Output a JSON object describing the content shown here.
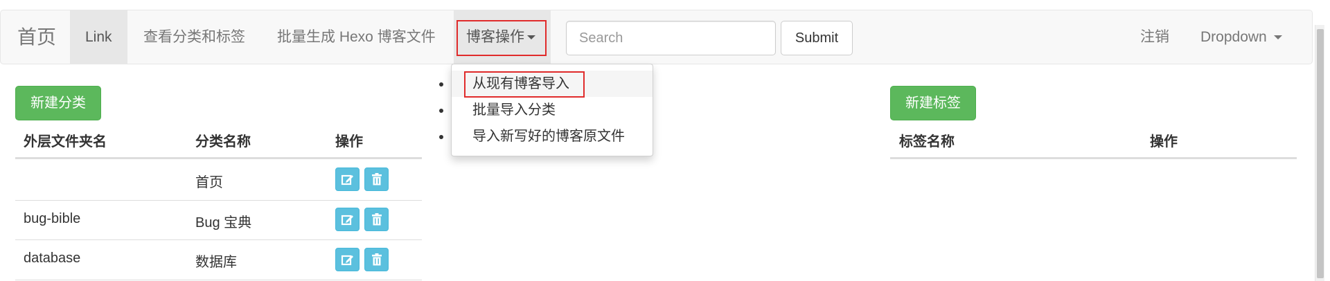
{
  "navbar": {
    "brand": "首页",
    "link": "Link",
    "view_categories": "查看分类和标签",
    "batch_generate": "批量生成 Hexo 博客文件",
    "blog_ops": "博客操作",
    "search_placeholder": "Search",
    "submit": "Submit",
    "logout": "注销",
    "dropdown": "Dropdown"
  },
  "blog_ops_menu": [
    {
      "label": "从现有博客导入"
    },
    {
      "label": "批量导入分类"
    },
    {
      "label": "导入新写好的博客原文件"
    }
  ],
  "categories": {
    "new_button": "新建分类",
    "headers": [
      "外层文件夹名",
      "分类名称",
      "操作"
    ],
    "rows": [
      {
        "folder": "",
        "name": "首页"
      },
      {
        "folder": "bug-bible",
        "name": "Bug 宝典"
      },
      {
        "folder": "database",
        "name": "数据库"
      }
    ]
  },
  "tags": {
    "new_button": "新建标签",
    "headers": [
      "标签名称",
      "操作"
    ]
  },
  "icons": {
    "edit": "edit-icon",
    "delete": "trash-icon",
    "caret": "caret-down-icon"
  },
  "colors": {
    "success": "#5cb85c",
    "info": "#5bc0de",
    "highlight": "#e02b2b",
    "navbar_bg": "#f8f8f8"
  }
}
